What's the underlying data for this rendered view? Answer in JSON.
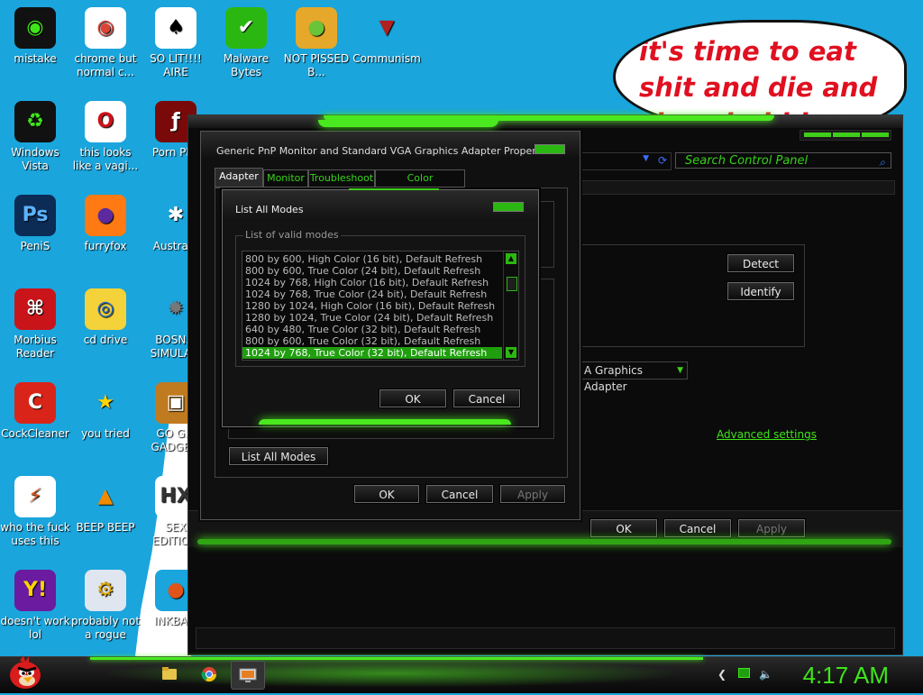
{
  "desktop": {
    "icons": [
      {
        "label": "mistake",
        "icon": "razer-snake-icon"
      },
      {
        "label": "chrome but normal c...",
        "icon": "chrome-icon"
      },
      {
        "label": "SO LIT!!!! AIRE",
        "icon": "solitaire-cards-icon"
      },
      {
        "label": "Malware Bytes",
        "icon": "shield-check-icon"
      },
      {
        "label": "NOT PISSED B...",
        "icon": "angry-pig-icon"
      },
      {
        "label": "Communism",
        "icon": "bird-emblem-icon"
      },
      {
        "label": "Windows Vista",
        "icon": "recycle-bin-icon"
      },
      {
        "label": "this looks like a vagi...",
        "icon": "opera-icon"
      },
      {
        "label": "Porn Pl...",
        "icon": "flash-player-icon"
      },
      {
        "label": "PeniS",
        "icon": "photoshop-icon"
      },
      {
        "label": "furryfox",
        "icon": "firefox-icon"
      },
      {
        "label": "Austra...",
        "icon": "spider-icon"
      },
      {
        "label": "Morbius Reader",
        "icon": "acrobat-reader-icon"
      },
      {
        "label": "cd drive",
        "icon": "cd-drive-icon"
      },
      {
        "label": "BOSN... SIMULA...",
        "icon": "spiked-ball-icon"
      },
      {
        "label": "CockCleaner",
        "icon": "ccleaner-icon"
      },
      {
        "label": "you tried",
        "icon": "star-icon"
      },
      {
        "label": "GO G... GADGE...",
        "icon": "briefcase-icon"
      },
      {
        "label": "who the fuck uses this",
        "icon": "lightning-icon"
      },
      {
        "label": "BEEP BEEP",
        "icon": "vlc-cone-icon"
      },
      {
        "label": "SEX EDITIO...",
        "icon": "hex-editor-icon"
      },
      {
        "label": "doesn't work lol",
        "icon": "yahoo-messenger-icon"
      },
      {
        "label": "probably not a rogue",
        "icon": "monitor-gears-icon"
      },
      {
        "label": "INKBA...",
        "icon": "ink-ball-icon"
      }
    ],
    "sticker_text": "it's time to eat shit and die and chew bubble gum"
  },
  "control_panel": {
    "search_placeholder": "Search Control Panel",
    "detect_label": "Detect",
    "identify_label": "Identify",
    "adapter_combo": "A Graphics Adapter",
    "advanced_settings_link": "Advanced settings",
    "ok_label": "OK",
    "cancel_label": "Cancel",
    "apply_label": "Apply"
  },
  "properties_dialog": {
    "title": "Generic PnP Monitor and Standard VGA Graphics Adapter Properties",
    "tabs": [
      "Adapter",
      "Monitor",
      "Troubleshoot",
      "Color Management"
    ],
    "active_tab": "Adapter",
    "list_all_modes_button": "List All Modes",
    "ok_label": "OK",
    "cancel_label": "Cancel",
    "apply_label": "Apply"
  },
  "list_modes_dialog": {
    "title": "List All Modes",
    "group_caption": "List of valid modes",
    "modes": [
      "800 by 600, High Color (16 bit), Default Refresh",
      "800 by 600, True Color (24 bit), Default Refresh",
      "1024 by 768, High Color (16 bit), Default Refresh",
      "1024 by 768, True Color (24 bit), Default Refresh",
      "1280 by 1024, High Color (16 bit), Default Refresh",
      "1280 by 1024, True Color (24 bit), Default Refresh",
      "640 by 480, True Color (32 bit), Default Refresh",
      "800 by 600, True Color (32 bit), Default Refresh",
      "1024 by 768, True Color (32 bit), Default Refresh"
    ],
    "selected_mode": "1024 by 768, True Color (32 bit), Default Refresh",
    "ok_label": "OK",
    "cancel_label": "Cancel"
  },
  "taskbar": {
    "clock": "4:17 AM",
    "pinned": [
      "folder-icon",
      "chrome-icon",
      "display-settings-icon"
    ],
    "tray": [
      "arrow-icon",
      "network-icon",
      "volume-icon"
    ]
  },
  "colors": {
    "accent_green": "#3fe51a",
    "desktop_blue": "#1aa5dc",
    "sticker_red": "#e01020"
  }
}
